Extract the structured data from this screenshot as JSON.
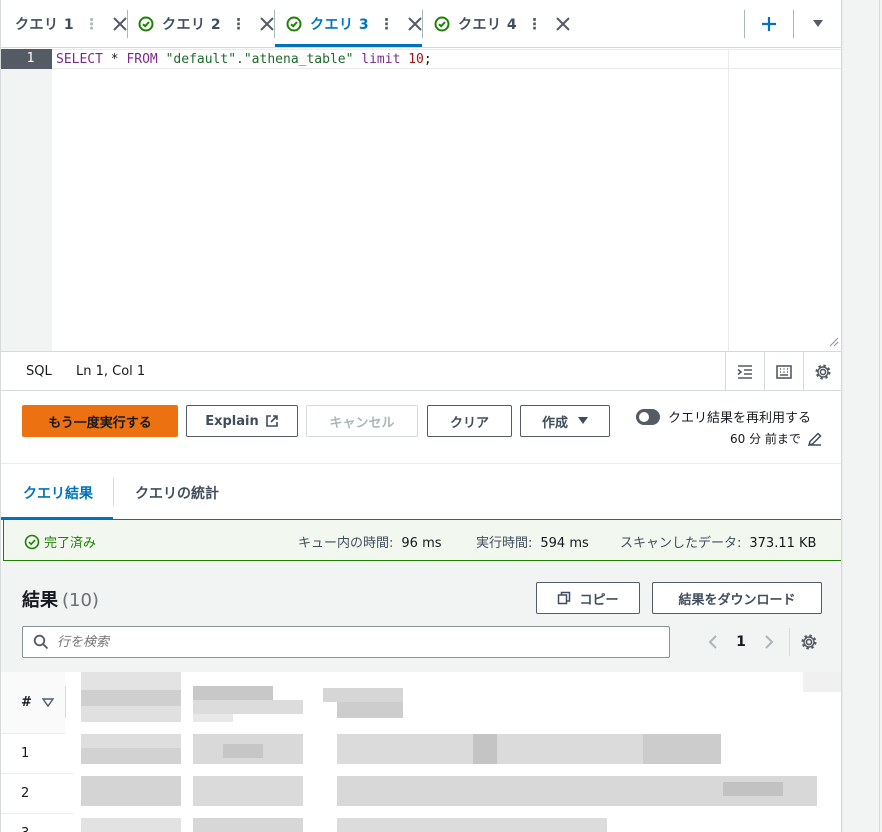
{
  "tabs": [
    {
      "label": "クエリ 1",
      "status": "none",
      "active": false
    },
    {
      "label": "クエリ 2",
      "status": "success",
      "active": false
    },
    {
      "label": "クエリ 3",
      "status": "success",
      "active": true
    },
    {
      "label": "クエリ 4",
      "status": "success",
      "active": false
    }
  ],
  "tab_menu_glyph": "⋮",
  "editor": {
    "line_number": "1",
    "code": {
      "kw_select": "SELECT",
      "star": " * ",
      "kw_from": "FROM",
      "table_ref": " \"default\".\"athena_table\" ",
      "kw_limit": "limit",
      "limit_value": " 10",
      "terminator": ";"
    }
  },
  "statusbar": {
    "language": "SQL",
    "position": "Ln 1, Col 1"
  },
  "actions": {
    "rerun": "もう一度実行する",
    "explain": "Explain",
    "cancel": "キャンセル",
    "clear": "クリア",
    "create": "作成",
    "reuse_label": "クエリ結果を再利用する",
    "reuse_sub": "60 分 前まで"
  },
  "result_tabs": {
    "results": "クエリ結果",
    "stats": "クエリの統計"
  },
  "banner": {
    "status": "完了済み",
    "queue_label": "キュー内の時間:",
    "queue_value": "96 ms",
    "exec_label": "実行時間:",
    "exec_value": "594 ms",
    "scan_label": "スキャンしたデータ:",
    "scan_value": "373.11 KB"
  },
  "results": {
    "title": "結果",
    "count": "(10)",
    "copy": "コピー",
    "download": "結果をダウンロード",
    "search_placeholder": "行を検索",
    "page": "1"
  },
  "table": {
    "index_header": "#",
    "rows": [
      "1",
      "2",
      "3"
    ]
  },
  "colors": {
    "accent": "#0073bb",
    "primary_button": "#ec7211",
    "success": "#1d8102"
  },
  "icons": [
    "check-circle-icon",
    "close-icon",
    "plus-icon",
    "caret-down-icon",
    "wrap-icon",
    "keyboard-icon",
    "gear-icon",
    "external-link-icon",
    "edit-icon",
    "copy-icon",
    "search-icon",
    "chevron-left-icon",
    "chevron-right-icon",
    "sort-icon"
  ]
}
